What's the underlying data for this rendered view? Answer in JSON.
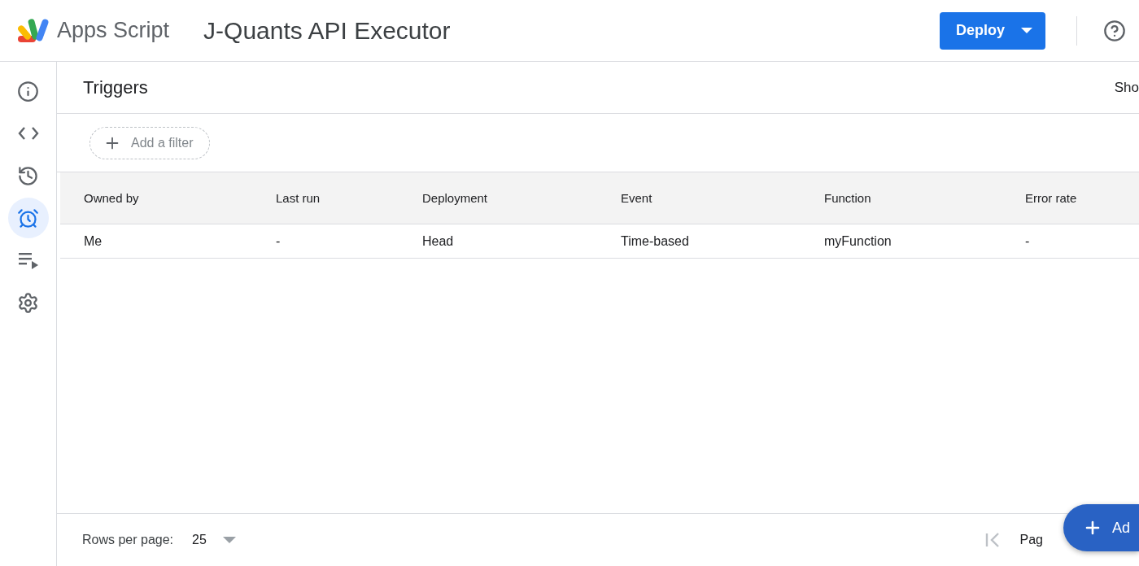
{
  "header": {
    "app_name": "Apps Script",
    "project_title": "J-Quants API Executor",
    "deploy_button": "Deploy"
  },
  "sidebar": {
    "items": [
      {
        "kind": "info",
        "selected": false
      },
      {
        "kind": "editor",
        "selected": false
      },
      {
        "kind": "history",
        "selected": false
      },
      {
        "kind": "triggers",
        "selected": true
      },
      {
        "kind": "executions",
        "selected": false
      },
      {
        "kind": "settings",
        "selected": false
      }
    ]
  },
  "page": {
    "title": "Triggers",
    "show_label": "Sho",
    "filter_button": "Add a filter"
  },
  "table": {
    "columns": [
      "Owned by",
      "Last run",
      "Deployment",
      "Event",
      "Function",
      "Error rate"
    ],
    "rows": [
      [
        "Me",
        "-",
        "Head",
        "Time-based",
        "myFunction",
        "-"
      ]
    ]
  },
  "footer": {
    "rows_per_page_label": "Rows per page:",
    "rows_per_page_value": "25",
    "page_label": "Pag"
  },
  "fab": {
    "label": "Ad"
  }
}
